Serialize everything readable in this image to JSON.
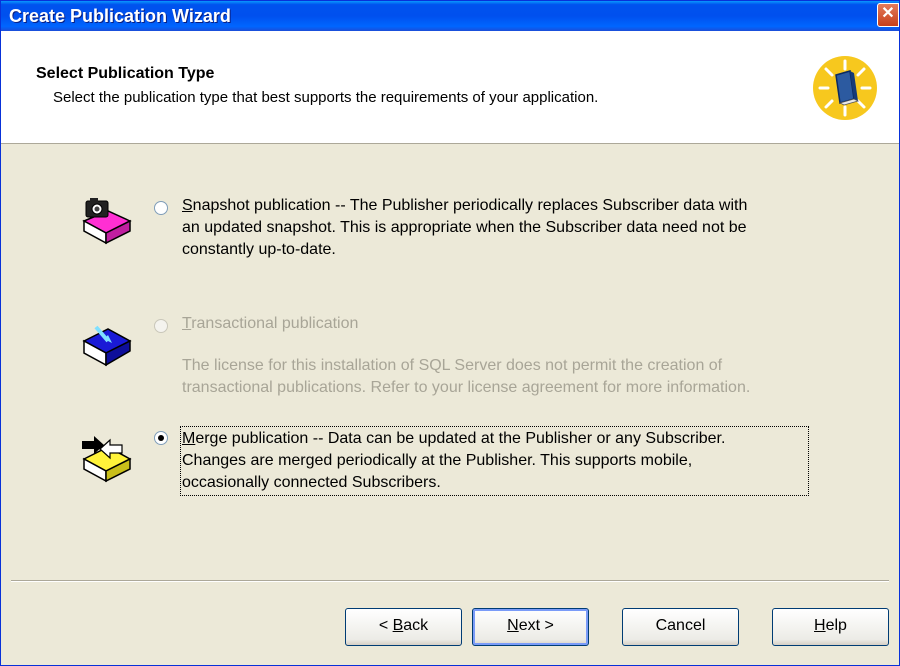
{
  "window": {
    "title": "Create Publication Wizard",
    "close_glyph": "✕"
  },
  "header": {
    "title": "Select Publication Type",
    "description": "Select the publication type that best supports the requirements of your application.",
    "icon": "wizard-book-icon"
  },
  "options": [
    {
      "name": "snapshot",
      "label_accel": "S",
      "label_rest": "napshot publication -- The Publisher periodically replaces Subscriber data with",
      "line2": "an updated snapshot. This is appropriate when the Subscriber data need not be",
      "line3": "constantly up-to-date.",
      "selected": false,
      "enabled": true,
      "icon": "snapshot-book-icon"
    },
    {
      "name": "transactional",
      "label_accel": "T",
      "label_rest": "ransactional publication",
      "note_line1": "The license for this installation of SQL Server does not permit the creation of",
      "note_line2": "transactional publications. Refer to your license agreement for more information.",
      "selected": false,
      "enabled": false,
      "icon": "transactional-book-icon"
    },
    {
      "name": "merge",
      "label_accel": "M",
      "label_rest": "erge publication -- Data can be updated at the Publisher or any Subscriber.",
      "line2": "Changes are merged periodically at the Publisher. This supports mobile,",
      "line3": "occasionally connected Subscribers.",
      "selected": true,
      "enabled": true,
      "icon": "merge-book-icon"
    }
  ],
  "buttons": {
    "back_prefix": "< ",
    "back_accel": "B",
    "back_rest": "ack",
    "next_accel": "N",
    "next_rest": "ext >",
    "cancel": "Cancel",
    "help_accel": "H",
    "help_rest": "elp"
  },
  "colors": {
    "titlebar": "#0053EE",
    "face": "#ECE9D8",
    "disabled_text": "#A8A597"
  }
}
